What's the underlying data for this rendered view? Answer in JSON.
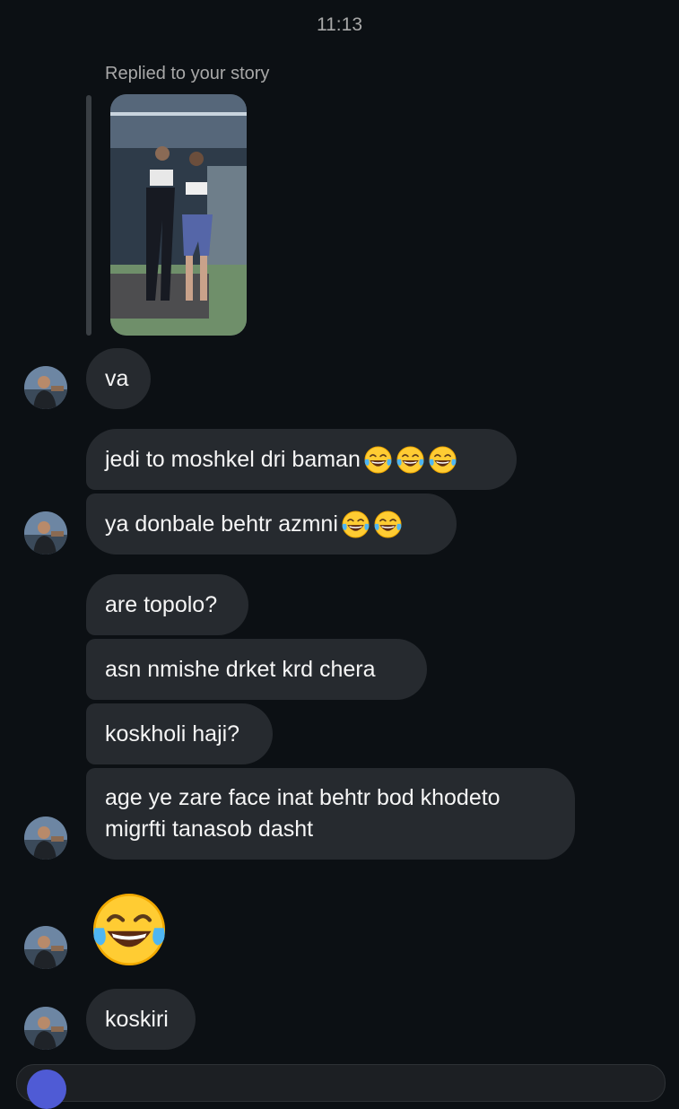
{
  "header": {
    "time": "11:13"
  },
  "story_reply": {
    "label": "Replied to your story"
  },
  "messages": [
    {
      "text": "va"
    },
    {
      "text": "jedi to moshkel dri baman",
      "emoji_count": 3
    },
    {
      "text": "ya donbale behtr azmni",
      "emoji_count": 2
    },
    {
      "text": "are topolo?"
    },
    {
      "text": "asn nmishe drket krd chera"
    },
    {
      "text": "koskholi haji?"
    },
    {
      "text": "age ye zare face inat behtr bod khodeto migrfti tanasob dasht"
    },
    {
      "text": "koskiri"
    }
  ],
  "icons": {
    "laughing": "face-with-tears-of-joy-icon",
    "camera": "camera-icon"
  },
  "colors": {
    "background": "#0c1014",
    "bubble": "#262a2f",
    "muted_text": "#a8a8a8",
    "camera_button": "#4f5bd5"
  }
}
